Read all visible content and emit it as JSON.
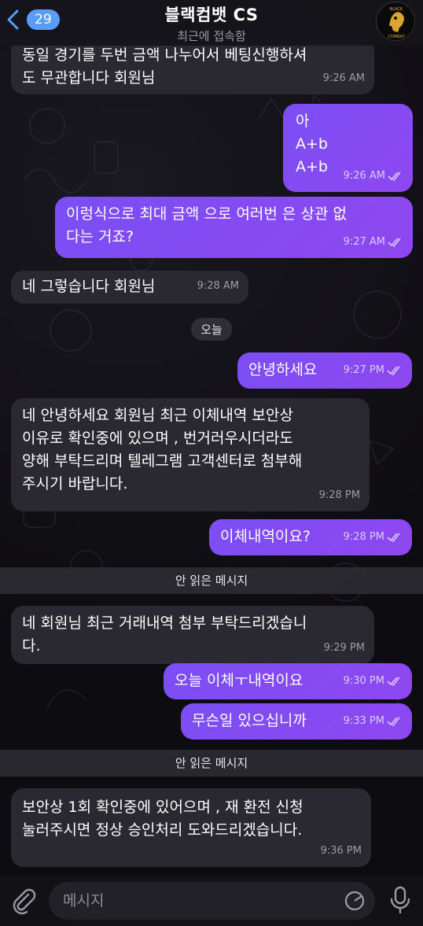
{
  "header": {
    "back_count": "29",
    "title": "블랙컴뱃 CS",
    "status": "최근에 접속함",
    "avatar_text_top": "BLACK",
    "avatar_text_bottom": "COMBAT"
  },
  "messages": [
    {
      "dir": "in",
      "lines": [
        "동일 경기를 두번 금액 나누어서 베팅신행하셔",
        "도 무관합니다 회원님"
      ],
      "time": "9:26 AM"
    },
    {
      "dir": "out",
      "lines": [
        "아",
        "A+b",
        "A+b"
      ],
      "time": "9:26 AM"
    },
    {
      "dir": "out",
      "lines": [
        "이렁식으로 최대 금액 으로 여러번 은 상관 없",
        "다는 거죠?"
      ],
      "time": "9:27 AM"
    },
    {
      "dir": "in",
      "lines": [
        "네 그렇습니다 회원님"
      ],
      "time": "9:28 AM"
    },
    {
      "dir": "out",
      "lines": [
        "안녕하세요"
      ],
      "time": "9:27 PM"
    },
    {
      "dir": "in",
      "lines": [
        "네 안녕하세요 회원님 최근 이체내역 보안상",
        "이유로 확인중에 있으며 , 번거러우시더라도",
        "양해 부탁드리며 텔레그램 고객센터로 첨부해",
        "주시기 바랍니다."
      ],
      "time": "9:28 PM"
    },
    {
      "dir": "out",
      "lines": [
        "이체내역이요?"
      ],
      "time": "9:28 PM"
    },
    {
      "dir": "in",
      "lines": [
        "네 회원님 최근 거래내역 첨부 부탁드리겠습니",
        "다."
      ],
      "time": "9:29 PM"
    },
    {
      "dir": "out",
      "lines": [
        "오늘 이체ㅜ내역이요"
      ],
      "time": "9:30 PM"
    },
    {
      "dir": "out",
      "lines": [
        "무슨일 있으십니까"
      ],
      "time": "9:33 PM"
    },
    {
      "dir": "in",
      "lines": [
        "보안상 1회 확인중에 있어으며 , 재 환전 신청",
        "눌러주시면 정상 승인처리 도와드리겠습니다."
      ],
      "time": "9:36 PM"
    }
  ],
  "date_pill": "오늘",
  "unread_label_1": "안 읽은 메시지",
  "unread_label_2": "안 읽은 메시지",
  "composer": {
    "placeholder": "메시지"
  },
  "colors": {
    "accent": "#5a9cf8",
    "outgoing": "#7b4ef5",
    "incoming": "#2a2830"
  }
}
